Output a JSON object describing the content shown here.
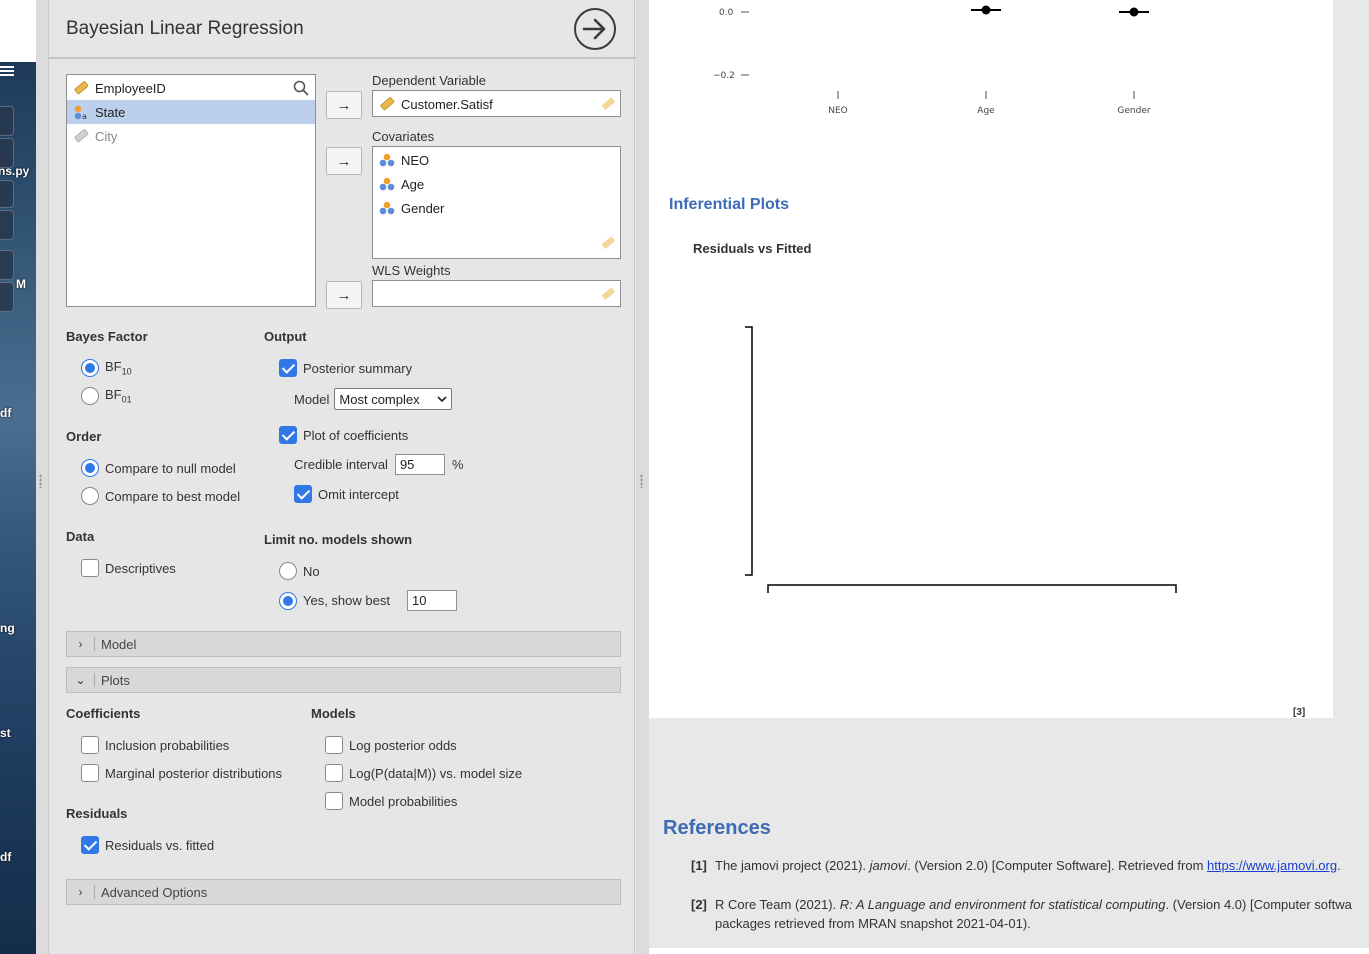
{
  "desktop": {
    "labels": [
      "ns.py",
      "M",
      "df",
      "ng",
      "st",
      "df"
    ]
  },
  "options": {
    "title": "Bayesian Linear Regression",
    "variables": [
      {
        "name": "EmployeeID",
        "type": "nominal-text"
      },
      {
        "name": "State",
        "type": "nominal",
        "selected": true
      },
      {
        "name": "City",
        "type": "id",
        "muted": true
      }
    ],
    "dependent_label": "Dependent Variable",
    "dependent_value": "Customer.Satisf",
    "covariates_label": "Covariates",
    "covariates": [
      "NEO",
      "Age",
      "Gender"
    ],
    "wls_label": "WLS Weights",
    "bayes_factor": {
      "label": "Bayes Factor",
      "options": [
        {
          "label": "BF",
          "sub": "10",
          "checked": true
        },
        {
          "label": "BF",
          "sub": "01",
          "checked": false
        }
      ]
    },
    "order": {
      "label": "Order",
      "options": [
        {
          "label": "Compare to null model",
          "checked": true
        },
        {
          "label": "Compare to best model",
          "checked": false
        }
      ]
    },
    "data_section": {
      "label": "Data",
      "descriptives": "Descriptives",
      "descriptives_checked": false
    },
    "output": {
      "label": "Output",
      "posterior_summary": "Posterior summary",
      "model_label": "Model",
      "model_value": "Most complex",
      "plot_of_coefficients": "Plot of coefficients",
      "credible_interval_label": "Credible interval",
      "credible_interval_value": "95",
      "credible_interval_unit": "%",
      "omit_intercept": "Omit intercept"
    },
    "limit_models": {
      "label": "Limit no. models shown",
      "no": "No",
      "yes": "Yes, show best",
      "yes_value": "10",
      "selected": "yes"
    },
    "sections": {
      "model": "Model",
      "plots": "Plots",
      "advanced": "Advanced Options"
    },
    "plots": {
      "coefficients_label": "Coefficients",
      "inclusion_probabilities": "Inclusion probabilities",
      "marginal_posterior": "Marginal posterior distributions",
      "models_label": "Models",
      "log_posterior_odds": "Log posterior odds",
      "log_p_data": "Log(P(data|M)) vs. model size",
      "model_probabilities": "Model probabilities",
      "residuals_label": "Residuals",
      "residuals_vs_fitted": "Residuals vs. fitted",
      "residuals_vs_fitted_checked": true
    }
  },
  "results": {
    "coef_plot": {
      "y_ticks": [
        "0.0",
        "−0.2"
      ],
      "x_labels": [
        "NEO",
        "Age",
        "Gender"
      ]
    },
    "inferential_heading": "Inferential Plots",
    "residuals_plot_title": "Residuals vs Fitted",
    "ref_badge": "[3]",
    "references_heading": "References",
    "references": [
      {
        "num": "[1]",
        "pre": "The jamovi project (2021). ",
        "italic": "jamovi",
        "post": ". (Version 2.0) [Computer Software]. Retrieved from ",
        "link": "https://www.jamovi.org",
        "tail": "."
      },
      {
        "num": "[2]",
        "pre": "R Core Team (2021). ",
        "italic": "R: A Language and environment for statistical computing",
        "post": ". (Version 4.0) [Computer softwa",
        "line2": "packages retrieved from MRAN snapshot 2021-04-01)."
      }
    ]
  },
  "colors": {
    "accent": "#2f78e6",
    "heading_blue": "#3e6bb5",
    "selection": "#bcd0ee",
    "ruler_icon": "#e8b84a",
    "nominal_blue": "#5b8dd8",
    "nominal_orange": "#f0a030"
  }
}
